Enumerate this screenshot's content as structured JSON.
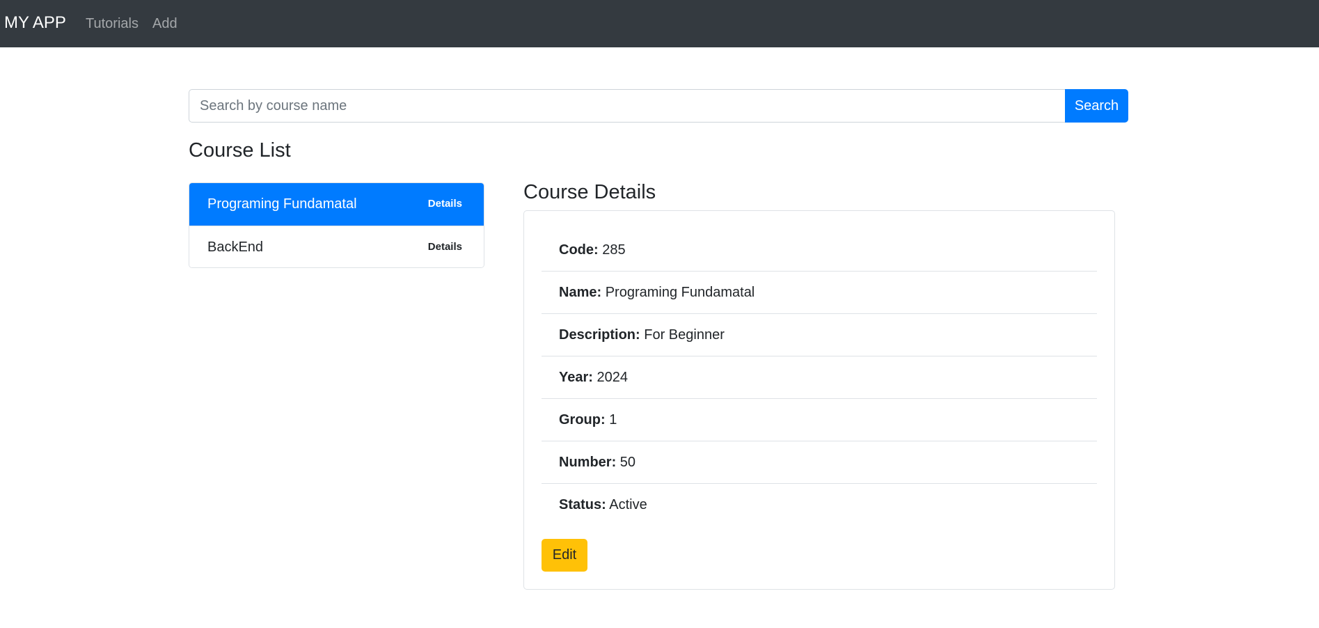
{
  "navbar": {
    "brand": "MY APP",
    "links": [
      "Tutorials",
      "Add"
    ]
  },
  "search": {
    "placeholder": "Search by course name",
    "value": "",
    "button_label": "Search"
  },
  "course_list": {
    "title": "Course List",
    "items": [
      {
        "name": "Programing Fundamatal",
        "details_label": "Details",
        "active": true
      },
      {
        "name": "BackEnd",
        "details_label": "Details",
        "active": false
      }
    ]
  },
  "course_details": {
    "title": "Course Details",
    "fields": [
      {
        "label": "Code:",
        "value": "285"
      },
      {
        "label": "Name:",
        "value": "Programing Fundamatal"
      },
      {
        "label": "Description:",
        "value": "For Beginner"
      },
      {
        "label": "Year:",
        "value": "2024"
      },
      {
        "label": "Group:",
        "value": "1"
      },
      {
        "label": "Number:",
        "value": "50"
      },
      {
        "label": "Status:",
        "value": "Active"
      }
    ],
    "edit_label": "Edit"
  },
  "colors": {
    "navbar_bg": "#343a40",
    "primary": "#007bff",
    "warning": "#ffc107"
  }
}
